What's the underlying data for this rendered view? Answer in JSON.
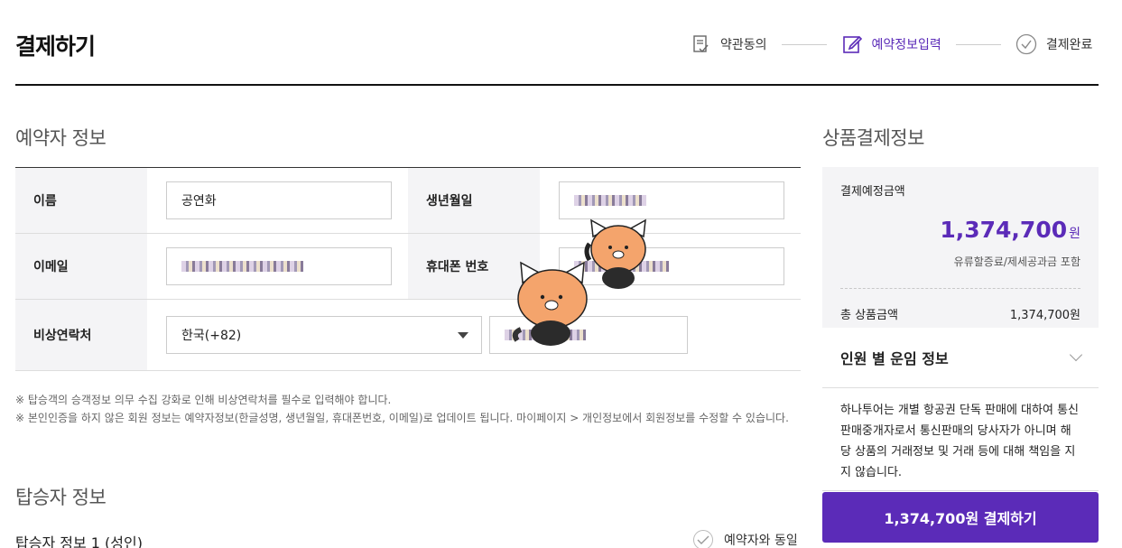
{
  "page": {
    "title": "결제하기"
  },
  "steps": [
    {
      "label": "약관동의",
      "icon": "document-check-icon"
    },
    {
      "label": "예약정보입력",
      "icon": "edit-icon"
    },
    {
      "label": "결제완료",
      "icon": "check-circle-icon"
    }
  ],
  "booker": {
    "title": "예약자 정보",
    "name_label": "이름",
    "name_value": "공연화",
    "birth_label": "생년월일",
    "email_label": "이메일",
    "phone_label": "휴대폰 번호",
    "emergency_label": "비상연락처",
    "country_value": "한국(+82)"
  },
  "notes": [
    "※ 탑승객의 승객정보 의무 수집 강화로 인해 비상연락처를 필수로 입력해야 합니다.",
    "※ 본인인증을 하지 않은 회원 정보는 예약자정보(한글성명, 생년월일, 휴대폰번호, 이메일)로 업데이트 됩니다. 마이페이지 > 개인정보에서 회원정보를 수정할 수 있습니다."
  ],
  "passenger": {
    "title": "탑승자 정보",
    "sub_title": "탑승자 정보 1 (성인)",
    "same_as_booker": "예약자와 동일"
  },
  "payment": {
    "title": "상품결제정보",
    "expected_label": "결제예정금액",
    "expected_amount": "1,374,700",
    "currency": "원",
    "amount_note": "유류할증료/제세공과금 포함",
    "total_label": "총 상품금액",
    "total_value": "1,374,700원",
    "accordion_label": "인원 별 운임 정보",
    "disclaimer": "하나투어는 개별 항공권 단독 판매에 대하여 통신판매중개자로서 통신판매의 당사자가 아니며 해당 상품의 거래정보 및 거래 등에 대해 책임을 지지 않습니다.",
    "pay_button": "1,374,700원 결제하기"
  },
  "colors": {
    "accent": "#5b2bb8",
    "label_bg": "#f4f4f6"
  }
}
